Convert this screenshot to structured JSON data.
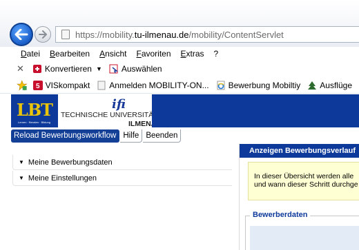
{
  "browser": {
    "url_prefix": "https://mobility.",
    "url_domain": "tu-ilmenau.de",
    "url_suffix": "/mobility/ContentServlet",
    "menu": [
      "Datei",
      "Bearbeiten",
      "Ansicht",
      "Favoriten",
      "Extras",
      "?"
    ],
    "commands": {
      "close_glyph": "✕",
      "convert_label": "Konvertieren",
      "select_label": "Auswählen"
    },
    "favorites": [
      {
        "label": "VISkompakt",
        "icon": "vis-icon"
      },
      {
        "label": "Anmelden MOBILITY-ON...",
        "icon": "page-icon"
      },
      {
        "label": "Bewerbung Mobiltiy",
        "icon": "ie-page-icon"
      },
      {
        "label": "Ausflüge",
        "icon": "tree-icon"
      }
    ]
  },
  "banner": {
    "logo_text": "LBT",
    "logo_subtext": "Lernen · Beraten · Bildung",
    "university_line": "TECHNISCHE UNIVERSITÄT",
    "city": "ILMENAU",
    "tu_mark": "ifi"
  },
  "tabs": [
    {
      "label": "Reload Bewerbungsworkflow",
      "active": true
    },
    {
      "label": "Hilfe",
      "active": false
    },
    {
      "label": "Beenden",
      "active": false
    }
  ],
  "accordion": [
    {
      "label": "Meine Bewerbungsdaten"
    },
    {
      "label": "Meine Einstellungen"
    }
  ],
  "right_panel": {
    "header": "Anzeigen Bewerbungsverlauf",
    "info_line1": "In dieser Übersicht werden alle",
    "info_line2": "und wann dieser Schritt durchge",
    "fieldset_legend": "Bewerberdaten"
  },
  "colors": {
    "brand_blue": "#0d3a9a",
    "logo_yellow": "#e9c40a",
    "info_bg": "#ffffd4"
  }
}
